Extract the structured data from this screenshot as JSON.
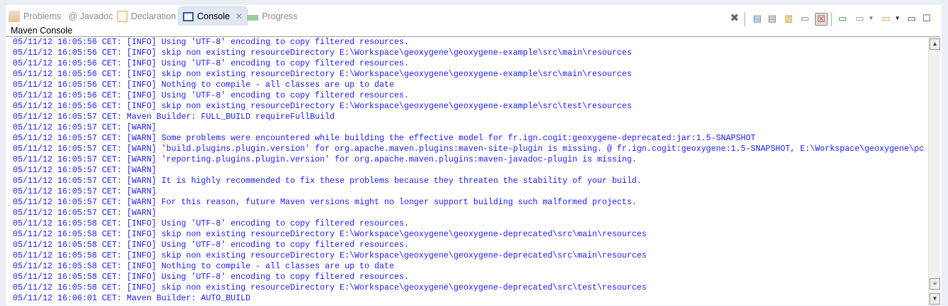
{
  "tabs": [
    {
      "label": "Problems",
      "icon": "problems-icon",
      "active": false
    },
    {
      "label": "@ Javadoc",
      "icon": "javadoc-icon",
      "active": false
    },
    {
      "label": "Declaration",
      "icon": "declaration-icon",
      "active": false
    },
    {
      "label": "Console",
      "icon": "console-icon",
      "active": true
    },
    {
      "label": "Progress",
      "icon": "progress-icon",
      "active": false
    }
  ],
  "console_title": "Maven Console",
  "toolbar": [
    "terminate-icon",
    "debug-output-icon",
    "close-console-icon",
    "scroll-lock-icon",
    "show-on-output-icon",
    "show-on-error-icon",
    "pin-console-icon",
    "display-console-icon",
    "open-console-icon",
    "minimize-icon",
    "maximize-icon"
  ],
  "lines": [
    "05/11/12 16:05:56 CET: [INFO] Using 'UTF-8' encoding to copy filtered resources.",
    "05/11/12 16:05:56 CET: [INFO] skip non existing resourceDirectory E:\\Workspace\\geoxygene\\geoxygene-example\\src\\main\\resources",
    "05/11/12 16:05:56 CET: [INFO] Using 'UTF-8' encoding to copy filtered resources.",
    "05/11/12 16:05:56 CET: [INFO] skip non existing resourceDirectory E:\\Workspace\\geoxygene\\geoxygene-example\\src\\main\\resources",
    "05/11/12 16:05:56 CET: [INFO] Nothing to compile - all classes are up to date",
    "05/11/12 16:05:56 CET: [INFO] Using 'UTF-8' encoding to copy filtered resources.",
    "05/11/12 16:05:56 CET: [INFO] skip non existing resourceDirectory E:\\Workspace\\geoxygene\\geoxygene-example\\src\\test\\resources",
    "05/11/12 16:05:57 CET: Maven Builder: FULL_BUILD requireFullBuild",
    "05/11/12 16:05:57 CET: [WARN]",
    "05/11/12 16:05:57 CET: [WARN] Some problems were encountered while building the effective model for fr.ign.cogit:geoxygene-deprecated:jar:1.5-SNAPSHOT",
    "05/11/12 16:05:57 CET: [WARN] 'build.plugins.plugin.version' for org.apache.maven.plugins:maven-site-plugin is missing. @ fr.ign.cogit:geoxygene:1.5-SNAPSHOT, E:\\Workspace\\geoxygene\\pc",
    "05/11/12 16:05:57 CET: [WARN] 'reporting.plugins.plugin.version' for org.apache.maven.plugins:maven-javadoc-plugin is missing.",
    "05/11/12 16:05:57 CET: [WARN]",
    "05/11/12 16:05:57 CET: [WARN] It is highly recommended to fix these problems because they threaten the stability of your build.",
    "05/11/12 16:05:57 CET: [WARN]",
    "05/11/12 16:05:57 CET: [WARN] For this reason, future Maven versions might no longer support building such malformed projects.",
    "05/11/12 16:05:57 CET: [WARN]",
    "05/11/12 16:05:58 CET: [INFO] Using 'UTF-8' encoding to copy filtered resources.",
    "05/11/12 16:05:58 CET: [INFO] skip non existing resourceDirectory E:\\Workspace\\geoxygene\\geoxygene-deprecated\\src\\main\\resources",
    "05/11/12 16:05:58 CET: [INFO] Using 'UTF-8' encoding to copy filtered resources.",
    "05/11/12 16:05:58 CET: [INFO] skip non existing resourceDirectory E:\\Workspace\\geoxygene\\geoxygene-deprecated\\src\\main\\resources",
    "05/11/12 16:05:58 CET: [INFO] Nothing to compile - all classes are up to date",
    "05/11/12 16:05:58 CET: [INFO] Using 'UTF-8' encoding to copy filtered resources.",
    "05/11/12 16:05:58 CET: [INFO] skip non existing resourceDirectory E:\\Workspace\\geoxygene\\geoxygene-deprecated\\src\\test\\resources",
    "05/11/12 16:06:01 CET: Maven Builder: AUTO_BUILD"
  ],
  "colors": {
    "text": "#1a1aff",
    "tab_active": "#dee7f3"
  }
}
